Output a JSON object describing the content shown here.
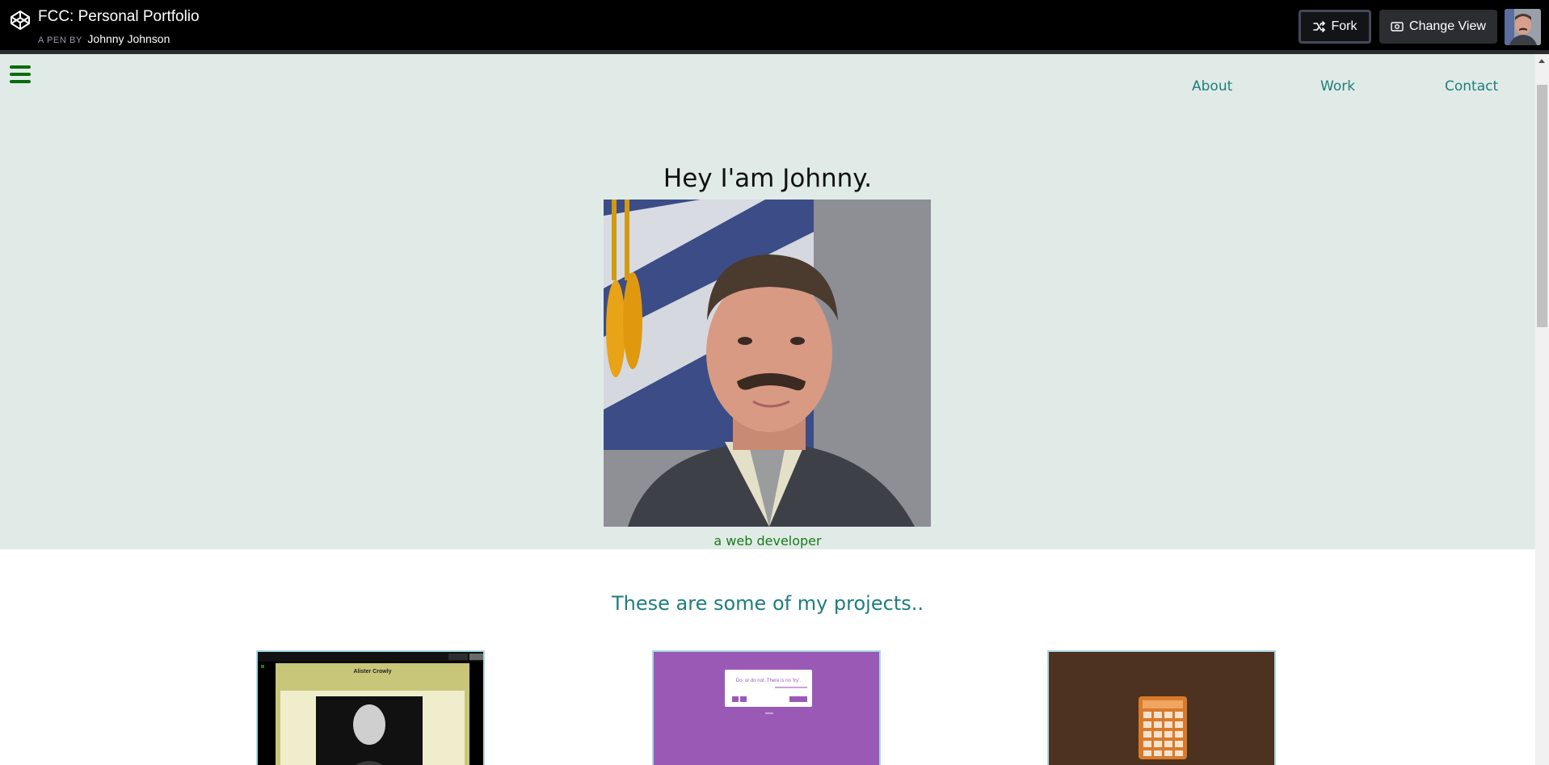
{
  "codepen": {
    "title": "FCC: Personal Portfolio",
    "byline": "A PEN BY",
    "author": "Johnny Johnson",
    "fork_label": "Fork",
    "change_view_label": "Change View"
  },
  "nav": {
    "menu_icon": "hamburger-icon",
    "links": [
      "About",
      "Work",
      "Contact"
    ]
  },
  "hero": {
    "title": "Hey I'am Johnny.",
    "subtitle": "a web developer"
  },
  "projects": {
    "heading": "These are some of my projects..",
    "cards": [
      {
        "thumb_title": "Alister Crowly"
      },
      {
        "thumb_quote": "Do, or do not. There is no 'try'."
      },
      {
        "thumb_kind": "calculator"
      }
    ]
  },
  "colors": {
    "header_bg": "#000000",
    "hero_bg": "#e0ebe7",
    "nav_link": "#1f7d7d",
    "accent_green": "#1a7a1a",
    "card_purple": "#9b59b6",
    "card_brown": "#4e3220"
  }
}
